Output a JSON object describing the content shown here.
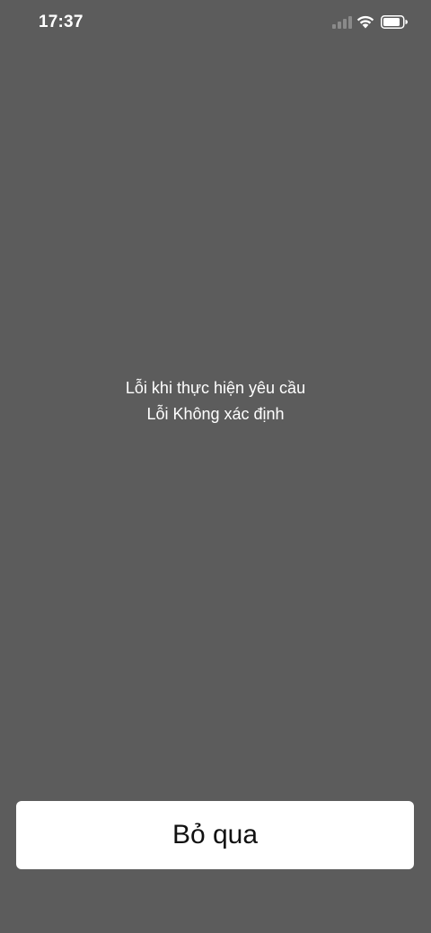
{
  "status_bar": {
    "time": "17:37",
    "signal_icon": "cellular-signal-icon",
    "wifi_icon": "wifi-icon",
    "battery_icon": "battery-icon"
  },
  "error": {
    "title": "Lỗi khi thực hiện yêu cầu",
    "message": "Lỗi Không xác định"
  },
  "actions": {
    "skip_label": "Bỏ qua"
  },
  "colors": {
    "background": "#5c5c5c",
    "button_background": "#ffffff",
    "text_light": "#ffffff",
    "text_dark": "#111111"
  }
}
